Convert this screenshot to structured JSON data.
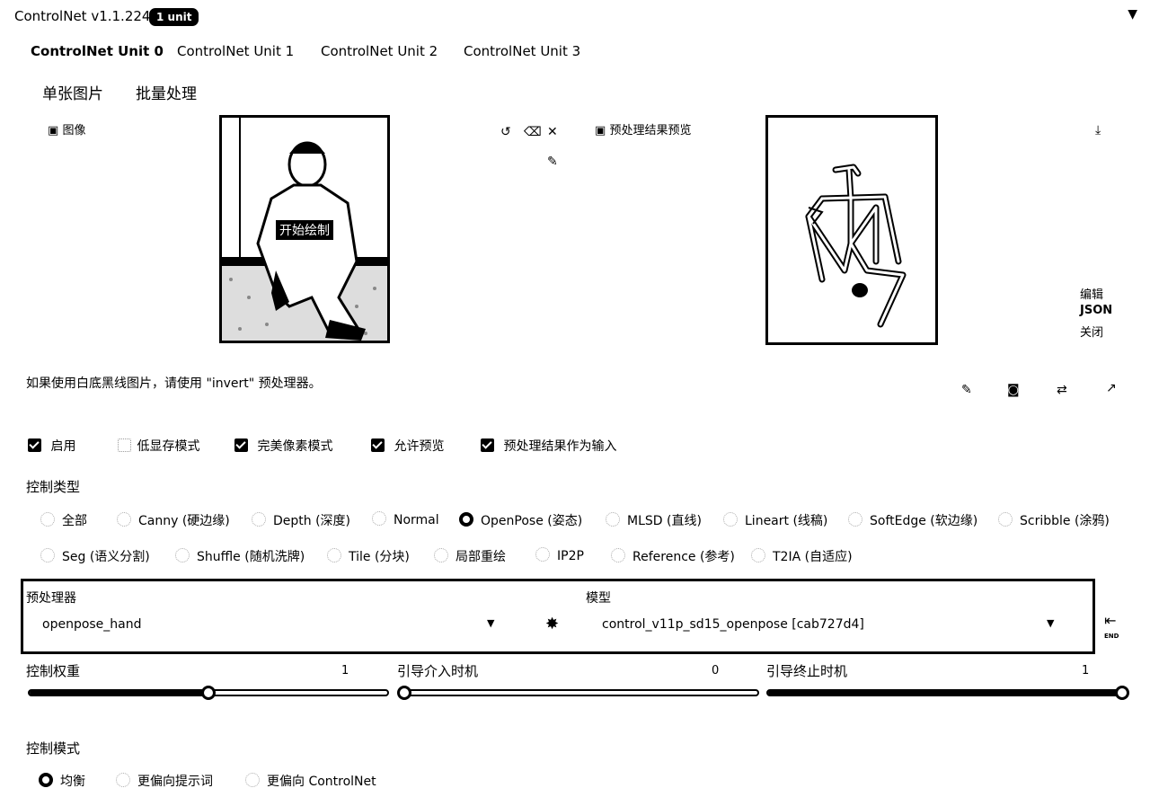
{
  "header": {
    "title": "ControlNet v1.1.224",
    "badge": "1 unit",
    "collapse_icon": "triangle-down-icon"
  },
  "unit_tabs": [
    "ControlNet Unit 0",
    "ControlNet Unit 1",
    "ControlNet Unit 2",
    "ControlNet Unit 3"
  ],
  "active_unit_tab": 0,
  "sub_tabs": [
    "单张图片",
    "批量处理"
  ],
  "image_panel": {
    "label": "图像",
    "overlay_text": "开始绘制",
    "tools": [
      "undo-icon",
      "eraser-icon",
      "close-icon",
      "brush-icon"
    ]
  },
  "preview_panel": {
    "label": "预处理结果预览",
    "download_icon": "download-icon",
    "links": [
      "编辑",
      "JSON",
      "关闭"
    ]
  },
  "hint": "如果使用白底黑线图片，请使用 \"invert\" 预处理器。",
  "action_icons": [
    "pencil-icon",
    "camera-icon",
    "swap-icon",
    "send-icon"
  ],
  "checkboxes": [
    {
      "label": "启用",
      "checked": true
    },
    {
      "label": "低显存模式",
      "checked": false
    },
    {
      "label": "完美像素模式",
      "checked": true
    },
    {
      "label": "允许预览",
      "checked": true
    },
    {
      "label": "预处理结果作为输入",
      "checked": true
    }
  ],
  "control_type": {
    "label": "控制类型",
    "row1": [
      "全部",
      "Canny (硬边缘)",
      "Depth (深度)",
      "Normal",
      "OpenPose (姿态)",
      "MLSD (直线)",
      "Lineart (线稿)",
      "SoftEdge (软边缘)",
      "Scribble (涂鸦)"
    ],
    "row2": [
      "Seg (语义分割)",
      "Shuffle (随机洗牌)",
      "Tile (分块)",
      "局部重绘",
      "IP2P",
      "Reference (参考)",
      "T2IA (自适应)"
    ],
    "selected": "OpenPose (姿态)"
  },
  "preprocessor": {
    "label": "预处理器",
    "value": "openpose_hand"
  },
  "model": {
    "label": "模型",
    "value": "control_v11p_sd15_openpose [cab727d4]"
  },
  "sliders": [
    {
      "label": "控制权重",
      "value": "1",
      "fraction": 0.5
    },
    {
      "label": "引导介入时机",
      "value": "0",
      "fraction": 0.0
    },
    {
      "label": "引导终止时机",
      "value": "1",
      "fraction": 1.0
    }
  ],
  "control_mode": {
    "label": "控制模式",
    "options": [
      "均衡",
      "更偏向提示词",
      "更偏向 ControlNet"
    ],
    "selected": "均衡"
  },
  "colors": {
    "ink": "#000000",
    "paper": "#ffffff"
  }
}
